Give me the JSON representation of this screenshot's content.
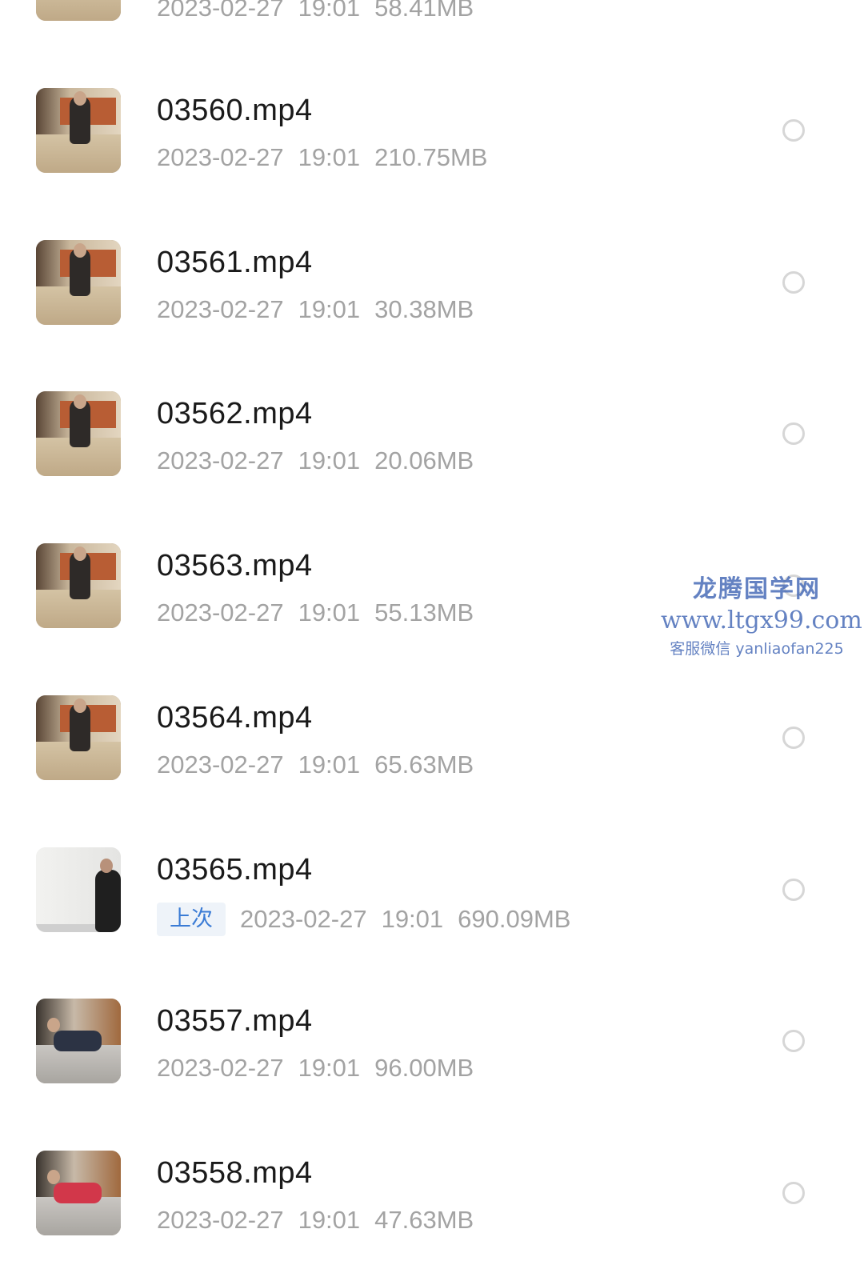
{
  "file_list": {
    "top_partial_item": {
      "meta": [
        "2023-02-27",
        "19:01",
        "58.41MB"
      ]
    },
    "items": [
      {
        "name": "03560.mp4",
        "date": "2023-02-27",
        "time": "19:01",
        "size": "210.75MB",
        "badge": "",
        "thumb": "bed"
      },
      {
        "name": "03561.mp4",
        "date": "2023-02-27",
        "time": "19:01",
        "size": "30.38MB",
        "badge": "",
        "thumb": "bed"
      },
      {
        "name": "03562.mp4",
        "date": "2023-02-27",
        "time": "19:01",
        "size": "20.06MB",
        "badge": "",
        "thumb": "bed"
      },
      {
        "name": "03563.mp4",
        "date": "2023-02-27",
        "time": "19:01",
        "size": "55.13MB",
        "badge": "",
        "thumb": "bed"
      },
      {
        "name": "03564.mp4",
        "date": "2023-02-27",
        "time": "19:01",
        "size": "65.63MB",
        "badge": "",
        "thumb": "bed"
      },
      {
        "name": "03565.mp4",
        "date": "2023-02-27",
        "time": "19:01",
        "size": "690.09MB",
        "badge": "上次",
        "thumb": "board"
      },
      {
        "name": "03557.mp4",
        "date": "2023-02-27",
        "time": "19:01",
        "size": "96.00MB",
        "badge": "",
        "thumb": "window"
      },
      {
        "name": "03558.mp4",
        "date": "2023-02-27",
        "time": "19:01",
        "size": "47.63MB",
        "badge": "",
        "thumb": "window-red"
      }
    ]
  },
  "watermark": {
    "name": "龙腾国学网",
    "url": "www.ltgx99.com",
    "contact": "客服微信 yanliaofan225"
  },
  "colors": {
    "name_text": "#1a1a1a",
    "meta_text": "#a3a3a3",
    "badge_text": "#3a7bd5",
    "badge_bg": "#eef3f9",
    "radio_border": "#d6d6d6",
    "watermark": "#4a6db8"
  }
}
